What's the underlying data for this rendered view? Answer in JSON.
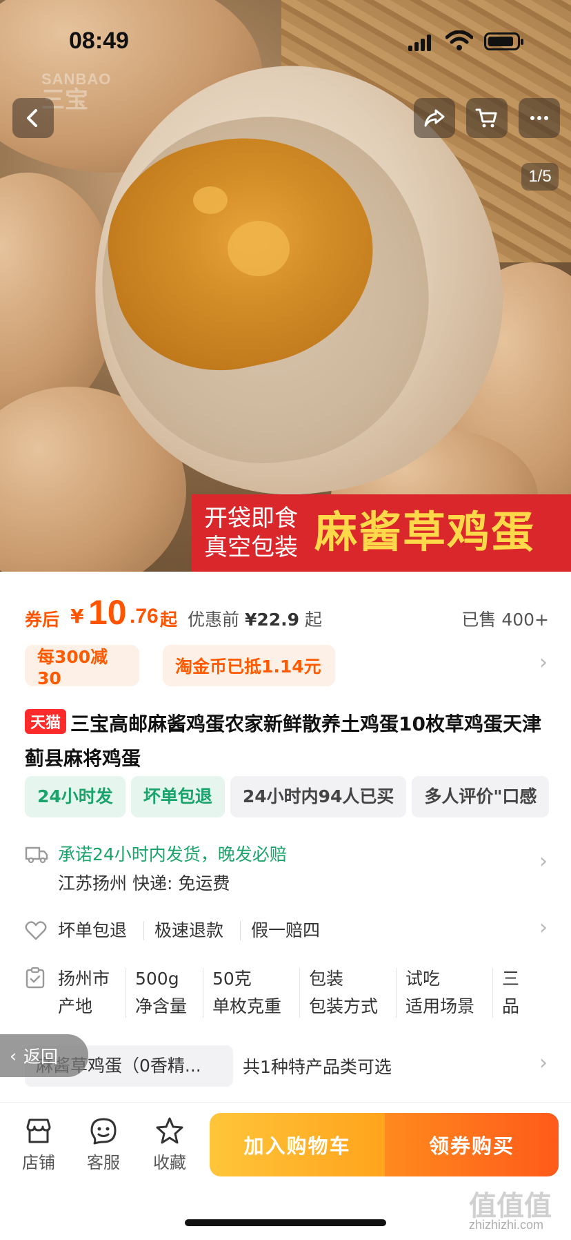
{
  "status_bar": {
    "time": "08:49"
  },
  "hero": {
    "logo_en": "SANBAO",
    "logo_cn": "三宝",
    "page_counter": "1/5",
    "banner_line1": "开袋即食",
    "banner_line2": "真空包装",
    "banner_title": "麻酱草鸡蛋",
    "icons": [
      "back-icon",
      "share-icon",
      "cart-icon",
      "more-icon"
    ]
  },
  "price": {
    "label": "券后",
    "currency": "¥",
    "integer": "10",
    "decimal": ".76",
    "suffix": "起",
    "original_label": "优惠前",
    "original_value": "¥22.9",
    "original_suffix": "起",
    "sold": "已售 400+"
  },
  "promos": [
    "每300减30",
    "淘金币已抵1.14元"
  ],
  "title": {
    "badge": "天猫",
    "text": "三宝高邮麻酱鸡蛋农家新鲜散养土鸡蛋10枚草鸡蛋天津蓟县麻将鸡蛋"
  },
  "tags": [
    {
      "label": "24小时发",
      "style": "green"
    },
    {
      "label": "坏单包退",
      "style": "green"
    },
    {
      "label": "24小时内94人已买",
      "style": "grey"
    },
    {
      "label": "多人评价\"口感",
      "style": "grey"
    }
  ],
  "shipping": {
    "promise": "承诺24小时内发货，晚发必赔",
    "info": "江苏扬州  快递: 免运费"
  },
  "guarantees": [
    "坏单包退",
    "极速退款",
    "假一赔四"
  ],
  "specs": [
    {
      "value": "扬州市",
      "key": "产地"
    },
    {
      "value": "500g",
      "key": "净含量"
    },
    {
      "value": "50克",
      "key": "单枚克重"
    },
    {
      "value": "包装",
      "key": "包装方式"
    },
    {
      "value": "试吃",
      "key": "适用场景"
    },
    {
      "value": "三",
      "key": "品"
    }
  ],
  "variant": {
    "chip": "麻酱草鸡蛋（0香精...",
    "note": "共1种特产品类可选"
  },
  "back_float": "返回",
  "bottom_bar": {
    "store": "店铺",
    "service": "客服",
    "favorite": "收藏",
    "add_to_cart": "加入购物车",
    "buy": "领券购买"
  },
  "watermark": {
    "cn": "值值值",
    "url": "zhizhizhi.com"
  },
  "colors": {
    "accent": "#ff5500",
    "tmall": "#ff2a2a",
    "green": "#1aa36a",
    "banner_red": "#d9272b",
    "banner_yellow": "#ffd94a"
  }
}
